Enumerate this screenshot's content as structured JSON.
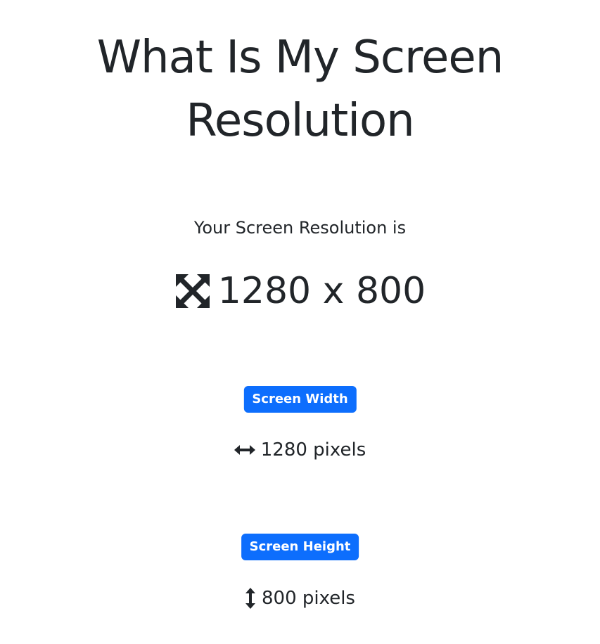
{
  "title": {
    "line1": "What Is My Screen",
    "line2": "Resolution"
  },
  "subtitle": "Your Screen Resolution is",
  "resolution": {
    "icon": "expand-arrows-icon",
    "text": "1280 x 800"
  },
  "width": {
    "badge": "Screen Width",
    "icon": "horizontal-arrows-icon",
    "value": "1280 pixels"
  },
  "height": {
    "badge": "Screen Height",
    "icon": "vertical-arrows-icon",
    "value": "800 pixels"
  },
  "colors": {
    "text": "#212529",
    "badge": "#0d6efd",
    "background": "#ffffff"
  }
}
